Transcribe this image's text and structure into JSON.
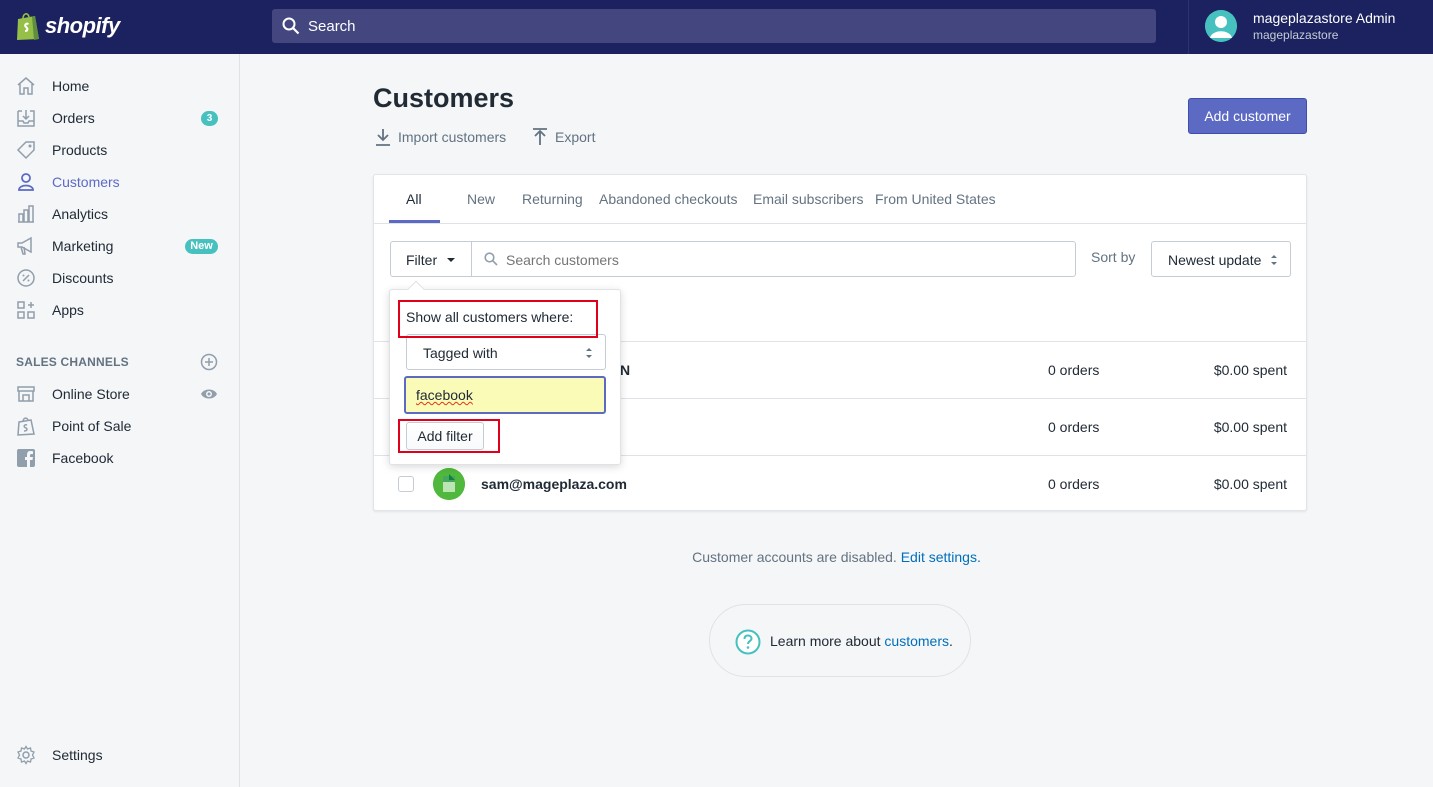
{
  "brand": {
    "name": "shopify"
  },
  "topbar": {
    "search_label": "Search",
    "user_name": "mageplazastore Admin",
    "user_store": "mageplazastore"
  },
  "sidebar": {
    "items": [
      {
        "label": "Home",
        "icon": "home-icon"
      },
      {
        "label": "Orders",
        "icon": "orders-icon",
        "badge": "3"
      },
      {
        "label": "Products",
        "icon": "tag-icon"
      },
      {
        "label": "Customers",
        "icon": "person-icon",
        "active": true
      },
      {
        "label": "Analytics",
        "icon": "bar-chart-icon"
      },
      {
        "label": "Marketing",
        "icon": "megaphone-icon",
        "badge": "New"
      },
      {
        "label": "Discounts",
        "icon": "discount-icon"
      },
      {
        "label": "Apps",
        "icon": "apps-icon"
      }
    ],
    "section_heading": "SALES CHANNELS",
    "channels": [
      {
        "label": "Online Store",
        "icon": "store-icon"
      },
      {
        "label": "Point of Sale",
        "icon": "pos-bag-icon"
      },
      {
        "label": "Facebook",
        "icon": "facebook-icon"
      }
    ],
    "settings_label": "Settings"
  },
  "page": {
    "title": "Customers",
    "import_label": "Import customers",
    "export_label": "Export",
    "add_button": "Add customer"
  },
  "tabs": [
    "All",
    "New",
    "Returning",
    "Abandoned checkouts",
    "Email subscribers",
    "From United States"
  ],
  "toolbar": {
    "filter_label": "Filter",
    "search_placeholder": "Search customers",
    "sort_label": "Sort by",
    "sort_value": "Newest update"
  },
  "customers": [
    {
      "name": "",
      "name_suffix_visible": "N",
      "orders": "0 orders",
      "spent": "$0.00 spent"
    },
    {
      "name": "",
      "orders": "0 orders",
      "spent": "$0.00 spent"
    },
    {
      "name": "sam@mageplaza.com",
      "orders": "0 orders",
      "spent": "$0.00 spent"
    }
  ],
  "filter_popover": {
    "title": "Show all customers where:",
    "condition": "Tagged with",
    "value": "facebook",
    "button": "Add filter"
  },
  "footer": {
    "note": "Customer accounts are disabled.",
    "note_link": "Edit settings.",
    "help_prefix": "Learn more about ",
    "help_link": "customers",
    "help_suffix": "."
  },
  "colors": {
    "topbar": "#1c2260",
    "accent": "#5c6ac4",
    "teal_badge": "#47c1bf",
    "highlight": "#e0001a"
  }
}
